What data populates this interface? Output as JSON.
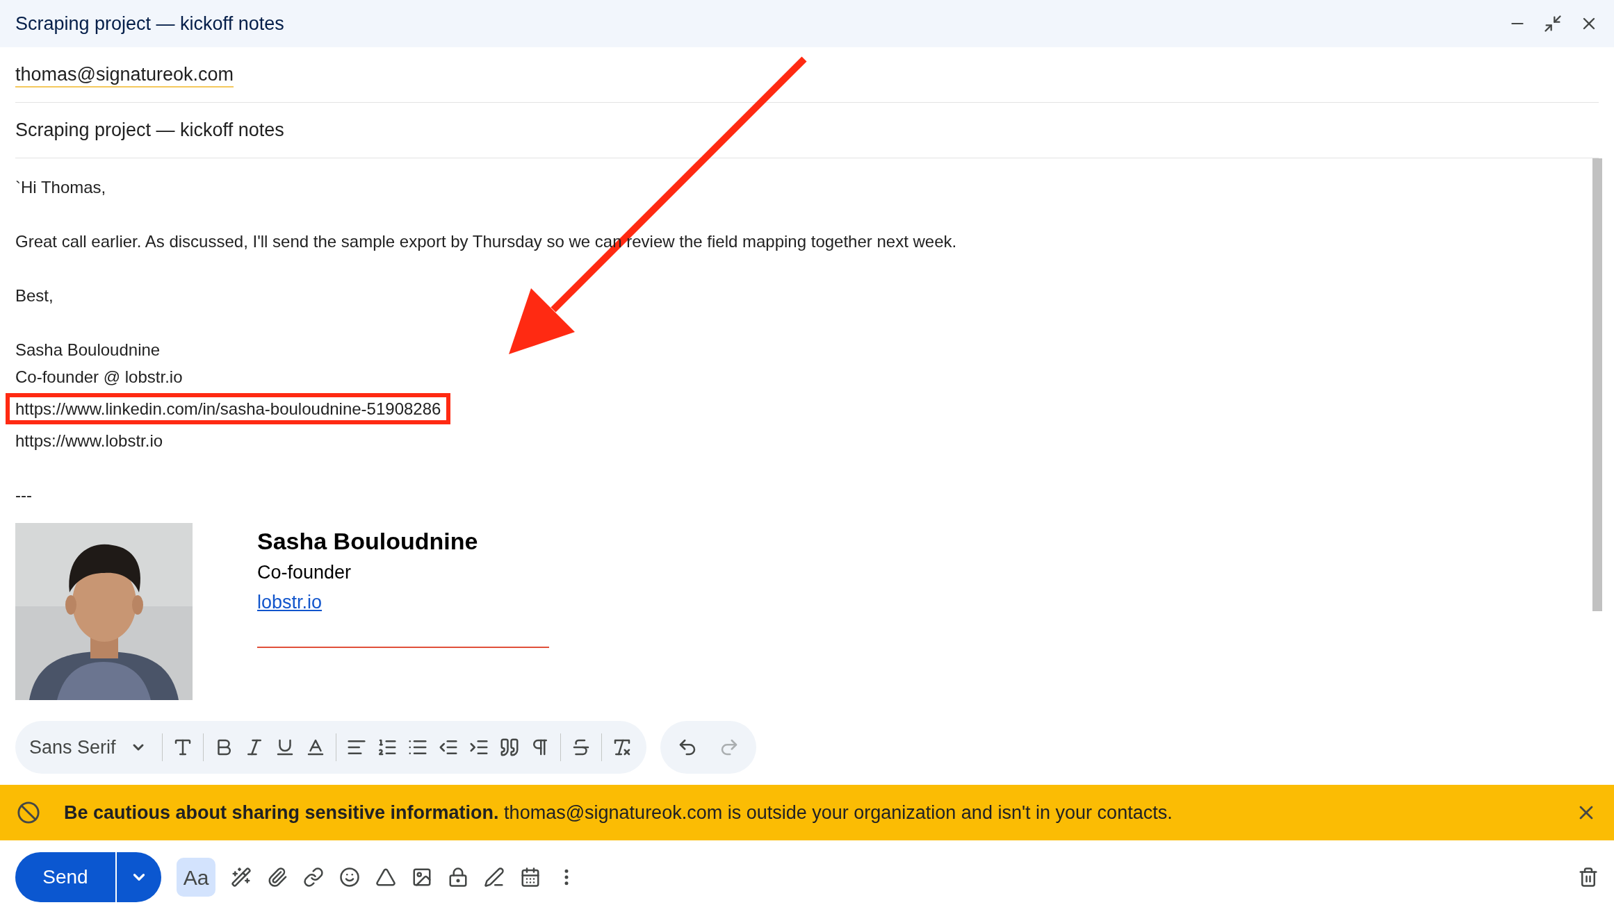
{
  "window": {
    "title": "Scraping project — kickoff notes"
  },
  "to": {
    "value": "thomas@signatureok.com"
  },
  "subject": {
    "value": "Scraping project — kickoff notes"
  },
  "body": {
    "paragraphs": [
      [
        {
          "text": "`Hi Thomas,",
          "highlighted": false
        }
      ],
      [
        {
          "text": "Great call earlier. As discussed, I'll send the sample export by Thursday so we can review the field mapping together next week.",
          "highlighted": false
        }
      ],
      [
        {
          "text": "Best,",
          "highlighted": false
        }
      ],
      [
        {
          "text": "Sasha Bouloudnine",
          "highlighted": false
        },
        {
          "text": "Co-founder @ lobstr.io",
          "highlighted": false
        },
        {
          "text": "https://www.linkedin.com/in/sasha-bouloudnine-51908286",
          "highlighted": true
        },
        {
          "text": "https://www.lobstr.io",
          "highlighted": false
        }
      ],
      [
        {
          "text": "---",
          "highlighted": false
        }
      ]
    ]
  },
  "signature": {
    "name": "Sasha Bouloudnine",
    "role": "Co-founder",
    "link": "lobstr.io"
  },
  "toolbar": {
    "font": "Sans Serif"
  },
  "banner": {
    "message": "**Be cautious about sharing sensitive information.** thomas@signatureok.com is outside your organization and isn't in your contacts."
  },
  "bottom_bar": {
    "send": "Send",
    "format_button": {
      "label": "Aa",
      "selected": true
    }
  }
}
